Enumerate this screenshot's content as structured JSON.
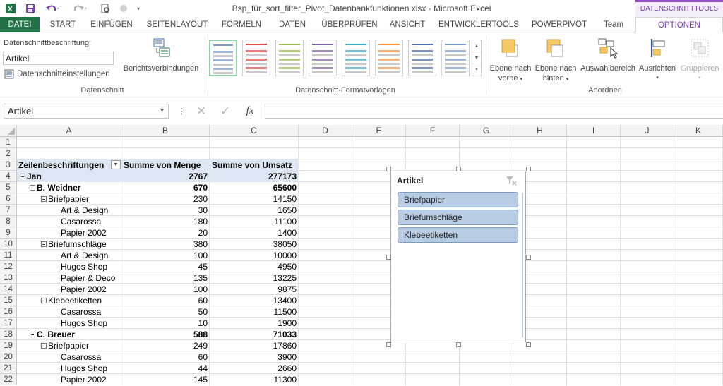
{
  "window": {
    "title": "Bsp_für_sort_filter_Pivot_Datenbankfunktionen.xlsx - Microsoft Excel",
    "context_tab_header": "DATENSCHNITTTOOLS"
  },
  "tabs": [
    "DATEI",
    "START",
    "EINFÜGEN",
    "SEITENLAYOUT",
    "FORMELN",
    "DATEN",
    "ÜBERPRÜFEN",
    "ANSICHT",
    "ENTWICKLERTOOLS",
    "POWERPIVOT",
    "Team",
    "OPTIONEN"
  ],
  "ribbon": {
    "caption_label": "Datenschnittbeschriftung:",
    "caption_value": "Artikel",
    "settings_label": "Datenschnitteinstellungen",
    "report_connections": "Berichtsverbindungen",
    "group_slicer": "Datenschnitt",
    "group_styles": "Datenschnitt-Formatvorlagen",
    "group_arrange": "Anordnen",
    "bring_forward": [
      "Ebene nach",
      "vorne"
    ],
    "send_backward": [
      "Ebene nach",
      "hinten"
    ],
    "selection_pane": "Auswahlbereich",
    "align": "Ausrichten",
    "group": "Gruppieren",
    "style_colors": [
      "#7f9cc8",
      "#d9534f",
      "#9bbb59",
      "#8064a2",
      "#4bacc6",
      "#f79646",
      "#4f6fa8"
    ]
  },
  "formula": {
    "namebox": "Artikel",
    "fx": "fx"
  },
  "columns": [
    "A",
    "B",
    "C",
    "D",
    "E",
    "F",
    "G",
    "H",
    "I",
    "J",
    "K"
  ],
  "rows": [
    {
      "n": "1",
      "a": "",
      "b": "",
      "c": ""
    },
    {
      "n": "2",
      "a": "",
      "b": "",
      "c": ""
    },
    {
      "n": "3",
      "a": "Zeilenbeschriftungen",
      "b": "Summe von Menge",
      "c": "Summe von Umsatz"
    },
    {
      "n": "4",
      "a": "Jan",
      "b": "2767",
      "c": "277173"
    },
    {
      "n": "5",
      "a": "B. Weidner",
      "b": "670",
      "c": "65600"
    },
    {
      "n": "6",
      "a": "Briefpapier",
      "b": "230",
      "c": "14150"
    },
    {
      "n": "7",
      "a": "Art & Design",
      "b": "30",
      "c": "1650"
    },
    {
      "n": "8",
      "a": "Casarossa",
      "b": "180",
      "c": "11100"
    },
    {
      "n": "9",
      "a": "Papier 2002",
      "b": "20",
      "c": "1400"
    },
    {
      "n": "10",
      "a": "Briefumschläge",
      "b": "380",
      "c": "38050"
    },
    {
      "n": "11",
      "a": "Art & Design",
      "b": "100",
      "c": "10000"
    },
    {
      "n": "12",
      "a": "Hugos Shop",
      "b": "45",
      "c": "4950"
    },
    {
      "n": "13",
      "a": "Papier & Deco",
      "b": "135",
      "c": "13225"
    },
    {
      "n": "14",
      "a": "Papier 2002",
      "b": "100",
      "c": "9875"
    },
    {
      "n": "15",
      "a": "Klebeetiketten",
      "b": "60",
      "c": "13400"
    },
    {
      "n": "16",
      "a": "Casarossa",
      "b": "50",
      "c": "11500"
    },
    {
      "n": "17",
      "a": "Hugos Shop",
      "b": "10",
      "c": "1900"
    },
    {
      "n": "18",
      "a": "C. Breuer",
      "b": "588",
      "c": "71033"
    },
    {
      "n": "19",
      "a": "Briefpapier",
      "b": "249",
      "c": "17860"
    },
    {
      "n": "20",
      "a": "Casarossa",
      "b": "60",
      "c": "3900"
    },
    {
      "n": "21",
      "a": "Hugos Shop",
      "b": "44",
      "c": "2660"
    },
    {
      "n": "22",
      "a": "Papier 2002",
      "b": "145",
      "c": "11300"
    }
  ],
  "slicer": {
    "title": "Artikel",
    "items": [
      "Briefpapier",
      "Briefumschläge",
      "Klebeetiketten"
    ]
  }
}
